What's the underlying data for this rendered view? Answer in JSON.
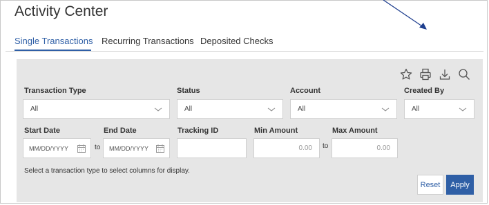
{
  "page": {
    "title": "Activity Center"
  },
  "tabs": [
    {
      "label": "Single Transactions",
      "active": true
    },
    {
      "label": "Recurring Transactions",
      "active": false
    },
    {
      "label": "Deposited Checks",
      "active": false
    }
  ],
  "toolbar": {
    "icons": [
      "star-icon",
      "print-icon",
      "download-icon",
      "search-icon"
    ]
  },
  "filters": {
    "transaction_type": {
      "label": "Transaction Type",
      "value": "All"
    },
    "status": {
      "label": "Status",
      "value": "All"
    },
    "account": {
      "label": "Account",
      "value": "All"
    },
    "created_by": {
      "label": "Created By",
      "value": "All"
    },
    "start_date": {
      "label": "Start Date",
      "placeholder": "MM/DD/YYYY"
    },
    "end_date": {
      "label": "End Date",
      "placeholder": "MM/DD/YYYY"
    },
    "date_separator": "to",
    "tracking_id": {
      "label": "Tracking ID",
      "value": ""
    },
    "min_amount": {
      "label": "Min Amount",
      "placeholder": "0.00"
    },
    "max_amount": {
      "label": "Max Amount",
      "placeholder": "0.00"
    },
    "amount_separator": "to"
  },
  "hint": "Select a transaction type to select columns for display.",
  "buttons": {
    "reset": "Reset",
    "apply": "Apply"
  },
  "colors": {
    "accent": "#2f5fa6",
    "panel_bg": "#e6e6e6",
    "arrow": "#1f3f8f"
  }
}
